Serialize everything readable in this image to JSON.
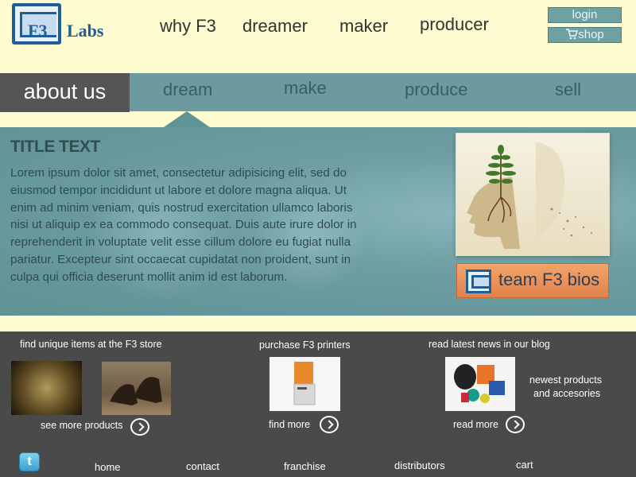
{
  "logo": {
    "mark": "F3",
    "name": "Labs"
  },
  "topnav": [
    "why F3",
    "dreamer",
    "maker",
    "producer"
  ],
  "account": {
    "login": "login",
    "shop": "shop",
    "shop_icon": "cart-icon"
  },
  "navbar": {
    "active": "about us",
    "items": [
      "dream",
      "make",
      "produce",
      "sell"
    ]
  },
  "main": {
    "title": "TITLE TEXT",
    "body": "Lorem ipsum dolor sit amet, consectetur adipisicing elit, sed do eiusmod tempor incididunt ut labore et dolore magna aliqua. Ut enim ad minim veniam, quis nostrud exercitation ullamco laboris nisi ut aliquip ex ea commodo consequat. Duis aute irure dolor in reprehenderit in voluptate velit esse cillum dolore eu fugiat nulla pariatur. Excepteur sint occaecat cupidatat non proident, sunt in culpa qui officia deserunt mollit anim id est laborum.",
    "bios_button": "team F3 bios"
  },
  "footer": {
    "store": {
      "heading": "find unique items at the F3 store",
      "link": "see more products"
    },
    "printers": {
      "heading": "purchase F3 printers",
      "link": "find more"
    },
    "blog": {
      "heading": "read latest news in our blog",
      "link": "read more",
      "caption_line1": "newest products",
      "caption_line2": "and accesories"
    }
  },
  "bottomnav": [
    "home",
    "contact",
    "franchise",
    "distributors",
    "cart"
  ],
  "colors": {
    "background": "#fdfbd0",
    "navbar": "#6c9aa0",
    "panel": "#6e9ea3",
    "footer": "#4a4a4a",
    "accent_orange": "#e2824a",
    "brand_blue": "#1f5e96"
  }
}
